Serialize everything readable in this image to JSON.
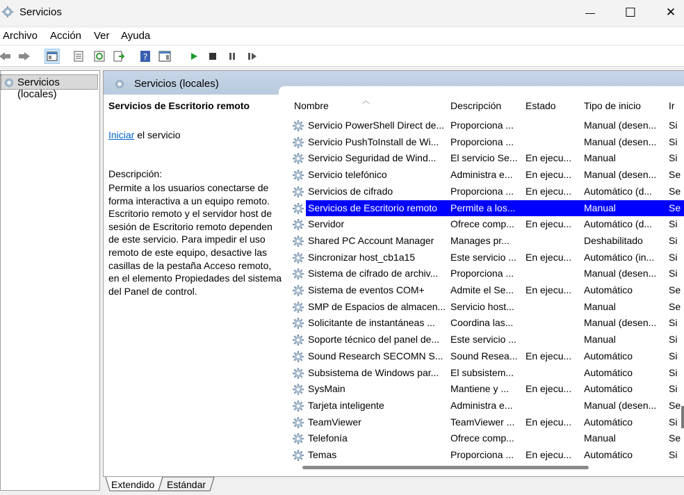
{
  "window": {
    "title": "Servicios",
    "minimize": "—",
    "maximize": "☐",
    "close": "✕"
  },
  "menu": [
    "Archivo",
    "Acción",
    "Ver",
    "Ayuda"
  ],
  "tree": {
    "label": "Servicios (locales)"
  },
  "header": {
    "label": "Servicios (locales)"
  },
  "description": {
    "title": "Servicios de Escritorio remoto",
    "action_link": "Iniciar",
    "action_rest": " el servicio",
    "label": "Descripción:",
    "body": "Permite a los usuarios conectarse de forma interactiva a un equipo remoto. Escritorio remoto y el servidor host de sesión de Escritorio remoto dependen de este servicio. Para impedir el uso remoto de este equipo, desactive las casillas de la pestaña Acceso remoto, en el elemento Propiedades del sistema del Panel de control."
  },
  "columns": {
    "name": "Nombre",
    "description": "Descripción",
    "status": "Estado",
    "startup": "Tipo de inicio",
    "logon": "Ir"
  },
  "rows": [
    {
      "name": "Servicio PowerShell Direct de...",
      "desc": "Proporciona ...",
      "status": "",
      "startup": "Manual (desen...",
      "logon": "Si"
    },
    {
      "name": "Servicio PushToInstall de Wi...",
      "desc": "Proporciona ...",
      "status": "",
      "startup": "Manual (desen...",
      "logon": "Si"
    },
    {
      "name": "Servicio Seguridad de Wind...",
      "desc": "El servicio Se...",
      "status": "En ejecu...",
      "startup": "Manual",
      "logon": "Si"
    },
    {
      "name": "Servicio telefónico",
      "desc": "Administra e...",
      "status": "En ejecu...",
      "startup": "Manual (desen...",
      "logon": "Se"
    },
    {
      "name": "Servicios de cifrado",
      "desc": "Proporciona ...",
      "status": "En ejecu...",
      "startup": "Automático (d...",
      "logon": "Se"
    },
    {
      "name": "Servicios de Escritorio remoto",
      "desc": "Permite a los...",
      "status": "",
      "startup": "Manual",
      "logon": "Se"
    },
    {
      "name": "Servidor",
      "desc": "Ofrece comp...",
      "status": "En ejecu...",
      "startup": "Automático (d...",
      "logon": "Si"
    },
    {
      "name": "Shared PC Account Manager",
      "desc": "Manages pr...",
      "status": "",
      "startup": "Deshabilitado",
      "logon": "Si"
    },
    {
      "name": "Sincronizar host_cb1a15",
      "desc": "Este servicio ...",
      "status": "En ejecu...",
      "startup": "Automático (in...",
      "logon": "Si"
    },
    {
      "name": "Sistema de cifrado de archiv...",
      "desc": "Proporciona ...",
      "status": "",
      "startup": "Manual (desen...",
      "logon": "Si"
    },
    {
      "name": "Sistema de eventos COM+",
      "desc": "Admite el Se...",
      "status": "En ejecu...",
      "startup": "Automático",
      "logon": "Se"
    },
    {
      "name": "SMP de Espacios de almacen...",
      "desc": "Servicio host...",
      "status": "",
      "startup": "Manual",
      "logon": "Se"
    },
    {
      "name": "Solicitante de instantáneas ...",
      "desc": "Coordina las...",
      "status": "",
      "startup": "Manual (desen...",
      "logon": "Si"
    },
    {
      "name": "Soporte técnico del panel de...",
      "desc": "Este servicio ...",
      "status": "",
      "startup": "Manual",
      "logon": "Si"
    },
    {
      "name": "Sound Research SECOMN S...",
      "desc": "Sound Resea...",
      "status": "En ejecu...",
      "startup": "Automático",
      "logon": "Si"
    },
    {
      "name": "Subsistema de Windows par...",
      "desc": "El subsistem...",
      "status": "",
      "startup": "Automático",
      "logon": "Si"
    },
    {
      "name": "SysMain",
      "desc": "Mantiene y ...",
      "status": "En ejecu...",
      "startup": "Automático",
      "logon": "Si"
    },
    {
      "name": "Tarjeta inteligente",
      "desc": "Administra e...",
      "status": "",
      "startup": "Manual (desen...",
      "logon": "Se"
    },
    {
      "name": "TeamViewer",
      "desc": "TeamViewer ...",
      "status": "En ejecu...",
      "startup": "Automático",
      "logon": "Si"
    },
    {
      "name": "Telefonía",
      "desc": "Ofrece comp...",
      "status": "",
      "startup": "Manual",
      "logon": "Se"
    },
    {
      "name": "Temas",
      "desc": "Proporciona ...",
      "status": "En ejecu...",
      "startup": "Automático",
      "logon": "Si"
    }
  ],
  "selected_index": 5,
  "tabs": [
    "Extendido",
    "Estándar"
  ],
  "colors": {
    "selection": "#0000ff",
    "link": "#0066cc",
    "header_band": "#c8d6e8"
  }
}
